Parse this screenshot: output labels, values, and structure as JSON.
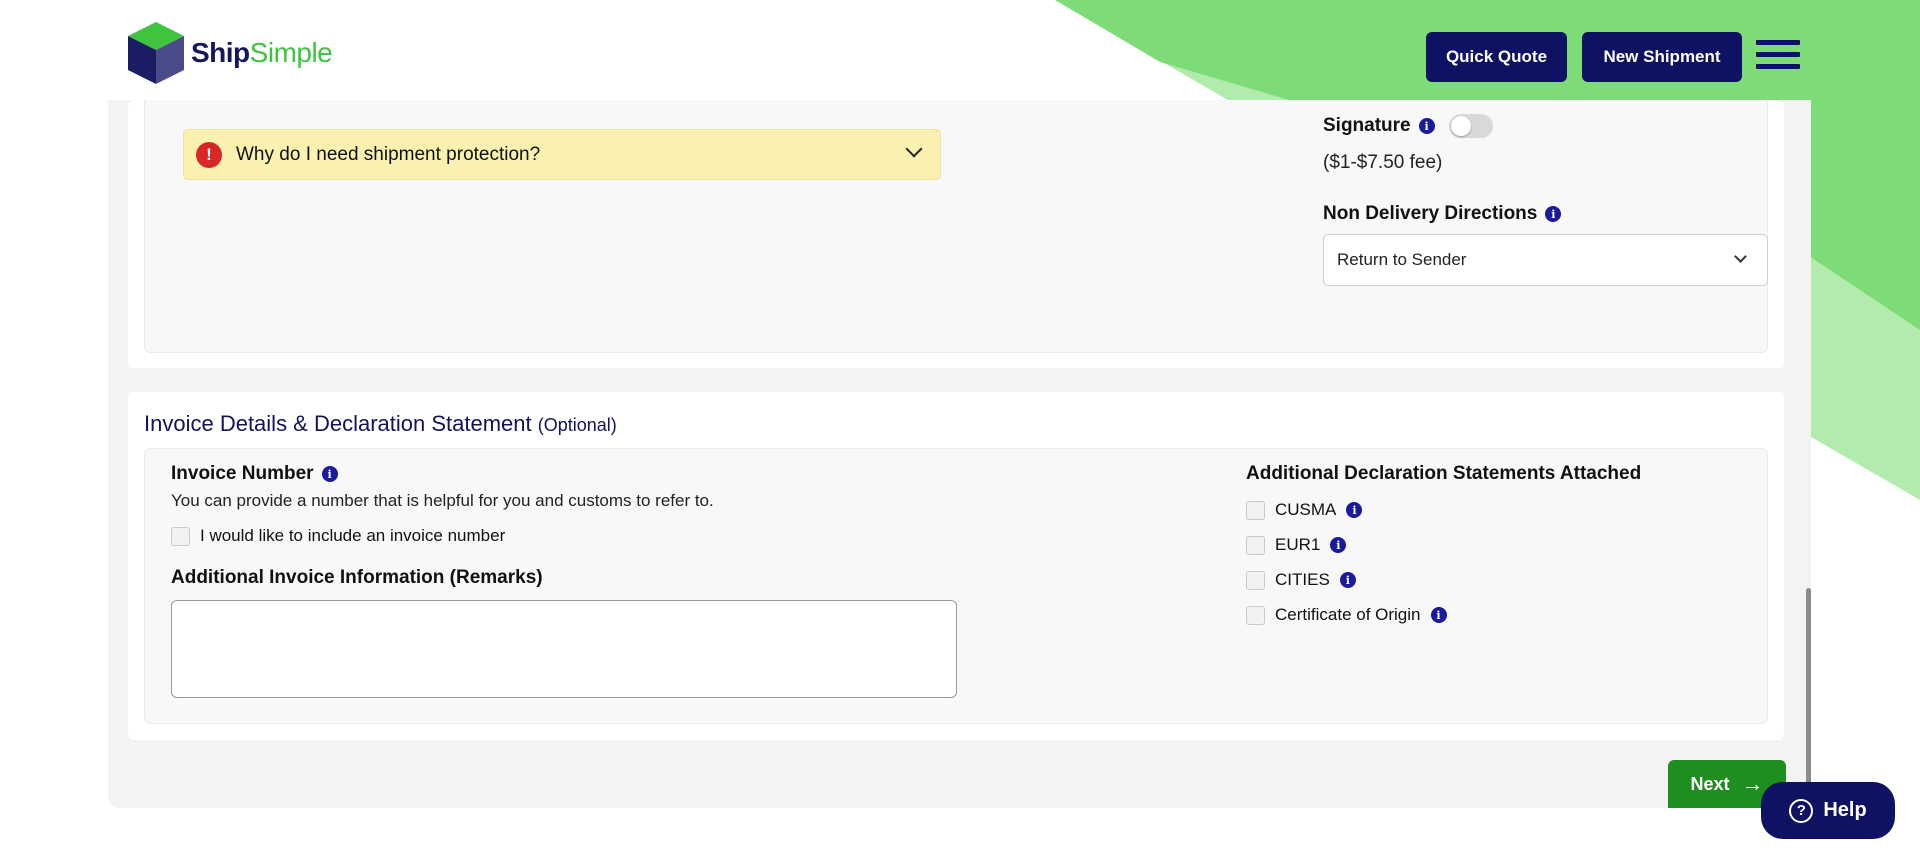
{
  "brand": {
    "name_part1": "Ship",
    "name_part2": "Simple"
  },
  "header": {
    "quick_quote": "Quick Quote",
    "new_shipment": "New Shipment"
  },
  "protection": {
    "alert_icon": "!",
    "alert_text": "Why do I need shipment protection?",
    "signature_label": "Signature",
    "signature_enabled": false,
    "signature_fee": "($1-$7.50 fee)",
    "non_delivery_label": "Non Delivery Directions",
    "non_delivery_value": "Return to Sender"
  },
  "invoice": {
    "title": "Invoice Details & Declaration Statement",
    "optional": "(Optional)",
    "number_label": "Invoice Number",
    "number_help": "You can provide a number that is helpful for you and customs to refer to.",
    "include_number_label": "I would like to include an invoice number",
    "remarks_label": "Additional Invoice Information (Remarks)",
    "remarks_value": "",
    "declarations_title": "Additional Declaration Statements Attached",
    "declarations": [
      {
        "label": "CUSMA",
        "checked": false
      },
      {
        "label": "EUR1",
        "checked": false
      },
      {
        "label": "CITIES",
        "checked": false
      },
      {
        "label": "Certificate of Origin",
        "checked": false
      }
    ]
  },
  "footer": {
    "next_label": "Next",
    "help_label": "Help"
  },
  "colors": {
    "navy": "#0f1163",
    "green_accent": "#3ec43e",
    "next_green": "#1e8f1e",
    "alert_bg": "#faf1b0",
    "info_blue": "#1a1a9c"
  },
  "icons": [
    "logo-cube-icon",
    "menu-icon",
    "alert-icon",
    "chevron-down-icon",
    "info-icon",
    "arrow-right-icon",
    "help-icon"
  ]
}
